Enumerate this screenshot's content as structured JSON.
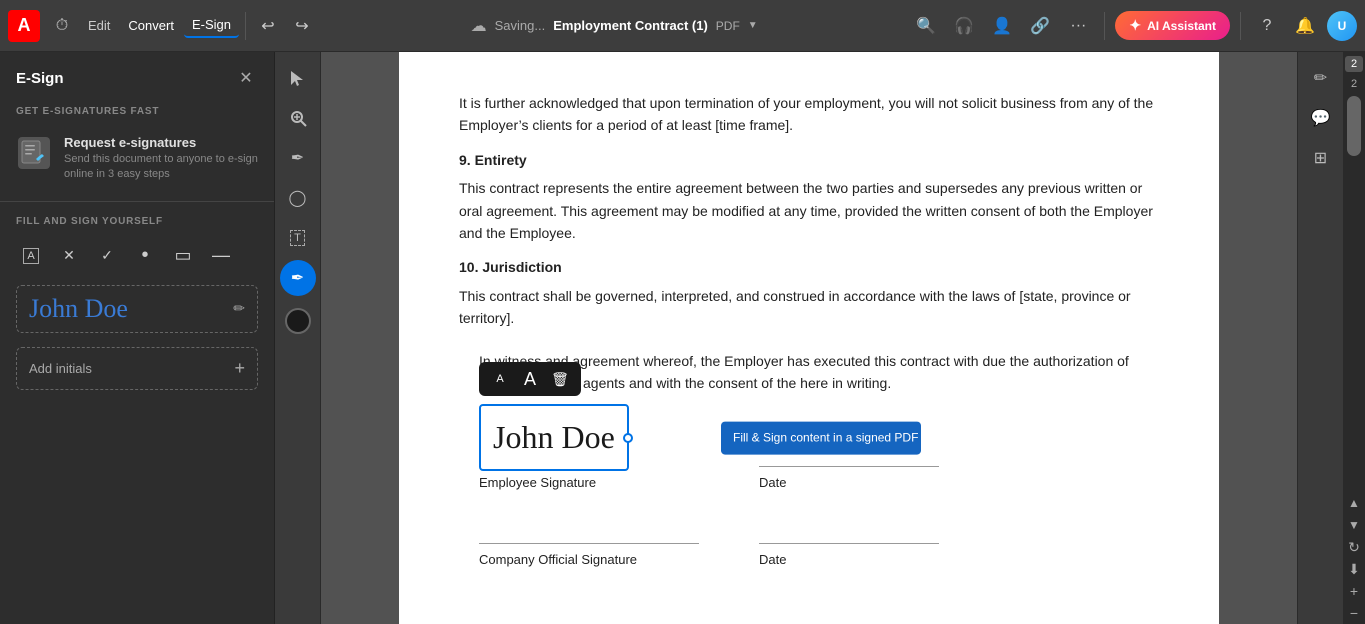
{
  "toolbar": {
    "logo": "A",
    "menu_items": [
      "Edit",
      "Convert",
      "E-Sign"
    ],
    "active_menu": "E-Sign",
    "saving_label": "Saving...",
    "doc_title": "Employment Contract (1)",
    "doc_type": "PDF",
    "ai_assistant_label": "AI Assistant",
    "undo_icon": "↩",
    "redo_icon": "↪"
  },
  "sidebar": {
    "title": "E-Sign",
    "section_get": "GET E-SIGNATURES FAST",
    "request_title": "Request e-signatures",
    "request_desc": "Send this document to anyone to e-sign online in 3 easy steps",
    "section_fill": "FILL AND SIGN YOURSELF",
    "signature_text": "John Doe",
    "add_initials_label": "Add initials"
  },
  "document": {
    "section9_heading": "9.   Entirety",
    "section9_text": "This contract represents the entire agreement between the two parties and supersedes any previous written or oral agreement. This agreement may be modified at any time, provided the written consent of both the Employer and the Employee.",
    "section10_heading": "10. Jurisdiction",
    "section10_text": "This contract shall be governed, interpreted, and construed in accordance with the laws of [state, province or territory].",
    "witness_text": "In witness and agreement whereof, the Employer has executed this contract with due the authorization of official company agents and with the consent of the here in writing.",
    "preamble_text": "It is further acknowledged that upon termination of your employment, you will not solicit business from any of the Employer’s clients for a period of at least [time frame].",
    "sig_employee_label": "Employee Signature",
    "sig_company_label": "Company Official Signature",
    "sig_date1_label": "Date",
    "sig_date2_label": "Date",
    "sig_value": "John Doe",
    "tooltip_text": "Fill & Sign content in a signed PDF can’t be modified in Acrobat Reader."
  },
  "page_number": {
    "badge": "2",
    "num": "2"
  },
  "icons": {
    "search": "🔍",
    "headphone": "🎧",
    "account": "👤",
    "link": "🔗",
    "more": "···",
    "bell": "🔔",
    "help": "?",
    "cursor": "↖",
    "zoom_in_tool": "⊕",
    "pen": "✒",
    "stamp": "◯",
    "text_add": "T",
    "checkmark": "✓",
    "circle": "●",
    "rect": "▭",
    "line": "—",
    "comment": "💬",
    "pages": "⊞",
    "edit_sign": "✏",
    "trash": "🗑",
    "font_small": "A",
    "font_large": "A",
    "color_swatch": "#1a1a1a",
    "right_edit": "✏",
    "right_comment": "💬",
    "right_grid": "⊞",
    "zoom_in": "+",
    "zoom_out": "−",
    "scroll_up": "▲",
    "scroll_down": "▼",
    "refresh": "↻",
    "download": "⬇"
  }
}
